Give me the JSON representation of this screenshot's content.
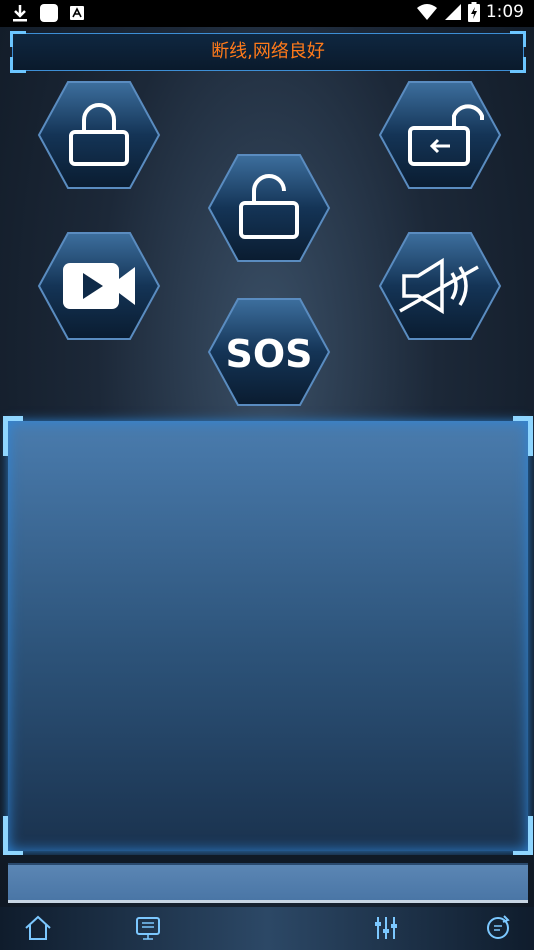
{
  "status_bar": {
    "time": "1:09",
    "icons": [
      "download-icon",
      "app-square-icon",
      "keyboard-a-icon",
      "wifi-icon",
      "signal-icon",
      "battery-icon"
    ]
  },
  "header": {
    "title": "断线,网络良好",
    "title_color": "#ff7a1a"
  },
  "controls": [
    {
      "id": "lock",
      "icon": "lock-icon"
    },
    {
      "id": "unlock",
      "icon": "unlock-icon"
    },
    {
      "id": "unlock-trunk",
      "icon": "unlock-return-icon"
    },
    {
      "id": "video",
      "icon": "video-camera-icon"
    },
    {
      "id": "sos",
      "icon": "sos-icon",
      "label": "SOS"
    },
    {
      "id": "mute",
      "icon": "mute-speaker-icon"
    }
  ],
  "bottom_nav": [
    {
      "id": "home",
      "icon": "home-icon"
    },
    {
      "id": "screen",
      "icon": "monitor-icon"
    },
    {
      "id": "settings",
      "icon": "sliders-icon"
    },
    {
      "id": "refresh",
      "icon": "refresh-icon"
    }
  ],
  "colors": {
    "accent": "#6cc6ff",
    "hex_fill": "#0f2a48",
    "icon_glow": "#ffffff"
  }
}
